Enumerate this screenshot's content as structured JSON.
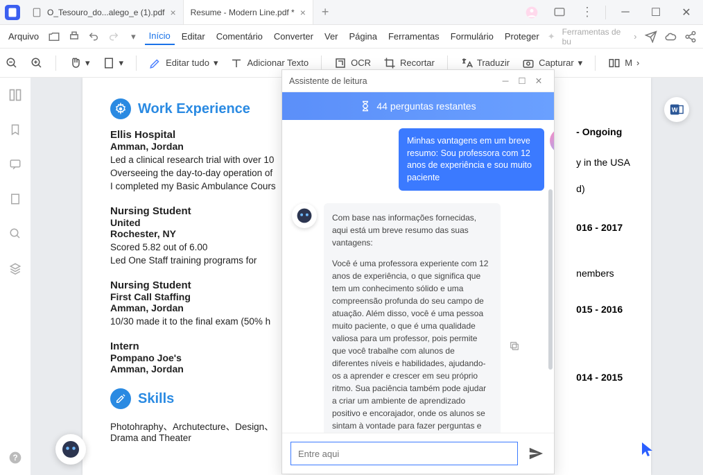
{
  "tabs": [
    {
      "label": "O_Tesouro_do...alego_e (1).pdf"
    },
    {
      "label": "Resume - Modern Line.pdf *"
    }
  ],
  "menu": {
    "file": "Arquivo",
    "items": [
      "Início",
      "Editar",
      "Comentário",
      "Converter",
      "Ver",
      "Página",
      "Ferramentas",
      "Formulário",
      "Proteger"
    ],
    "feature_hint": "Ferramentas de bu"
  },
  "toolbar": {
    "edit_all": "Editar tudo",
    "add_text": "Adicionar Texto",
    "ocr": "OCR",
    "crop": "Recortar",
    "translate": "Traduzir",
    "capture": "Capturar",
    "more": "M"
  },
  "assistant": {
    "title": "Assistente de leitura",
    "banner": "44 perguntas restantes",
    "user_msg": "Minhas vantagens em um breve resumo: Sou professora com 12 anos de experiência e sou muito paciente",
    "bot_intro": "Com base nas informações fornecidas, aqui está um breve resumo das suas vantagens:",
    "bot_body": "Você é uma professora experiente com 12 anos de experiência, o que significa que tem um conhecimento sólido e uma compreensão profunda do seu campo de atuação. Além disso, você é uma pessoa muito paciente, o que é uma qualidade valiosa para um professor, pois permite que você trabalhe com alunos de diferentes níveis e habilidades, ajudando-os a aprender e crescer em seu próprio ritmo. Sua paciência também pode ajudar a criar um ambiente de aprendizado positivo e encorajador, onde os alunos se sintam à vontade para fazer perguntas e explorar novos conceitos. Em resumo, suas vantagens incluem sua experiência e paciência,",
    "input_placeholder": "Entre aqui"
  },
  "resume": {
    "section_work": "Work Experience",
    "section_skills": "Skills",
    "entries": [
      {
        "title": "Ellis Hospital",
        "sub": "Amman, Jordan",
        "lines": [
          "Led a clinical research trial with over 10",
          "Overseeing the day-to-day operation of",
          "I completed my Basic Ambulance Cours"
        ]
      },
      {
        "title": "Nursing Student",
        "sub": "United",
        "sub2": "Rochester, NY",
        "lines": [
          "Scored 5.82 out of 6.00",
          "Led One Staff training programs for"
        ]
      },
      {
        "title": "Nursing Student",
        "sub": "First Call Staffing",
        "sub2": "Amman, Jordan",
        "lines": [
          "10/30 made it to the final exam (50% h"
        ]
      },
      {
        "title": "Intern",
        "sub": "Pompano Joe's",
        "sub2": "Amman, Jordan",
        "lines": []
      }
    ],
    "rightcol": {
      "r1": "- Ongoing",
      "r1b": "y in the USA",
      "r1c": "d)",
      "r2": "016 - 2017",
      "r2b": "nembers",
      "r3": "015 - 2016",
      "r4": "014 - 2015"
    },
    "skills_line1": "Photohraphy、Archutecture、Design、",
    "skills_line2": "Drama and Theater"
  }
}
